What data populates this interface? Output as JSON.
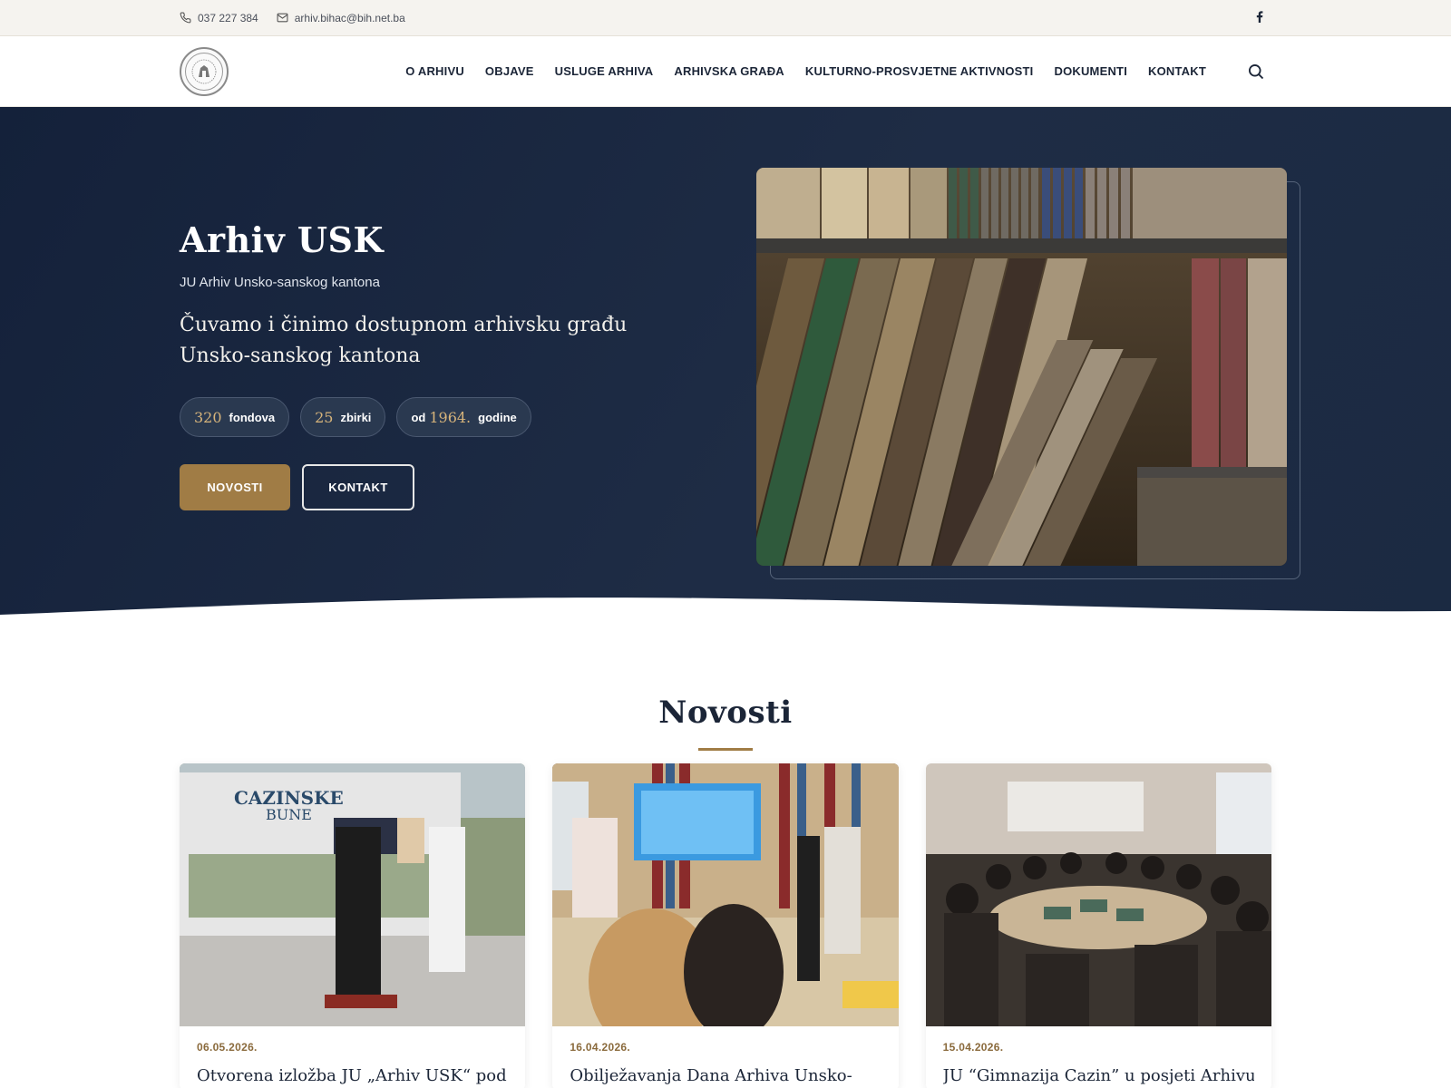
{
  "topbar": {
    "phone": "037 227 384",
    "email": "arhiv.bihac@bih.net.ba",
    "facebook_icon": "facebook-icon"
  },
  "header": {
    "logo_icon": "archive-seal-logo",
    "nav": [
      "O ARHIVU",
      "OBJAVE",
      "USLUGE ARHIVA",
      "ARHIVSKA GRAĐA",
      "KULTURNO-PROSVJETNE AKTIVNOSTI",
      "DOKUMENTI",
      "KONTAKT"
    ],
    "search_icon": "search-icon"
  },
  "hero": {
    "title": "Arhiv USK",
    "subtitle": "JU Arhiv Unsko-sanskog kantona",
    "tagline": "Čuvamo i činimo dostupnom arhivsku građu Unsko-sanskog kantona",
    "stats": [
      {
        "prefix": "",
        "number": "320",
        "label": "fondova"
      },
      {
        "prefix": "",
        "number": "25",
        "label": "zbirki"
      },
      {
        "prefix": "od",
        "number": "1964.",
        "label": "godine"
      }
    ],
    "primary_button": "NOVOSTI",
    "secondary_button": "KONTAKT"
  },
  "news": {
    "heading": "Novosti",
    "items": [
      {
        "date": "06.05.2026.",
        "title": "Otvorena izložba JU „Arhiv USK“ pod"
      },
      {
        "date": "16.04.2026.",
        "title": "Obilježavanja Dana Arhiva Unsko-"
      },
      {
        "date": "15.04.2026.",
        "title": "JU “Gimnazija Cazin” u posjeti Arhivu"
      }
    ]
  },
  "colors": {
    "navy": "#1b2940",
    "gold": "#a07c45",
    "stat_number": "#d7b47b"
  }
}
